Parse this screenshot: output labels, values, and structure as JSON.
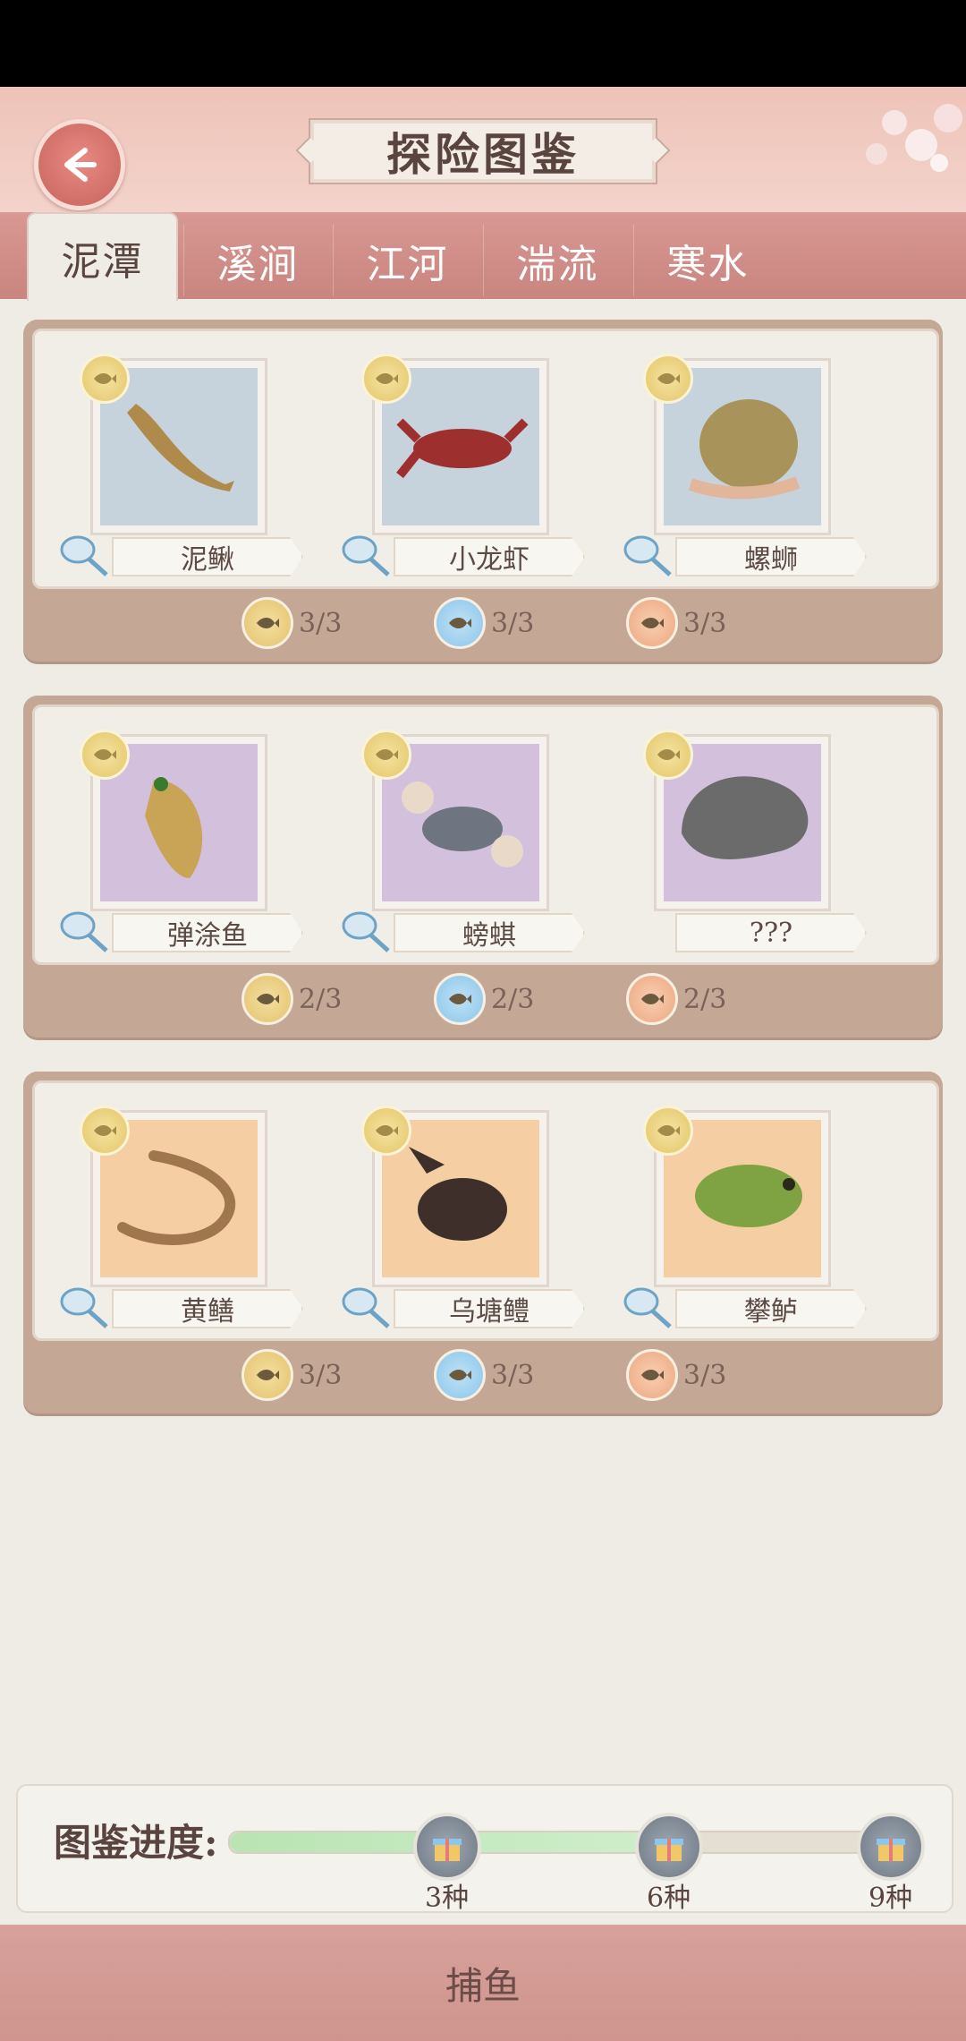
{
  "header": {
    "title": "探险图鉴",
    "back_icon": "back-arrow-icon"
  },
  "tabs": [
    {
      "label": "泥潭",
      "active": true
    },
    {
      "label": "溪涧",
      "active": false
    },
    {
      "label": "江河",
      "active": false
    },
    {
      "label": "湍流",
      "active": false
    },
    {
      "label": "寒水",
      "active": false
    }
  ],
  "groups": [
    {
      "items": [
        {
          "name": "泥鳅",
          "bg": "blue",
          "icon": "loach-icon"
        },
        {
          "name": "小龙虾",
          "bg": "blue",
          "icon": "crayfish-icon"
        },
        {
          "name": "螺蛳",
          "bg": "blue",
          "icon": "snail-icon"
        }
      ],
      "stats": [
        "3/3",
        "3/3",
        "3/3"
      ]
    },
    {
      "items": [
        {
          "name": "弹涂鱼",
          "bg": "purple",
          "icon": "mudskipper-icon"
        },
        {
          "name": "螃蜞",
          "bg": "purple",
          "icon": "crab-icon"
        },
        {
          "name": "???",
          "bg": "purple",
          "icon": "unknown-silhouette-icon"
        }
      ],
      "stats": [
        "2/3",
        "2/3",
        "2/3"
      ]
    },
    {
      "items": [
        {
          "name": "黄鳝",
          "bg": "orange",
          "icon": "eel-icon"
        },
        {
          "name": "乌塘鳢",
          "bg": "orange",
          "icon": "sleeper-fish-icon"
        },
        {
          "name": "攀鲈",
          "bg": "orange",
          "icon": "climbing-perch-icon"
        }
      ],
      "stats": [
        "3/3",
        "3/3",
        "3/3"
      ]
    }
  ],
  "progress": {
    "label": "图鉴进度:",
    "fill_percent": 67,
    "milestones": [
      "3种",
      "6种",
      "9种"
    ]
  },
  "bottom": {
    "label": "捕鱼"
  }
}
